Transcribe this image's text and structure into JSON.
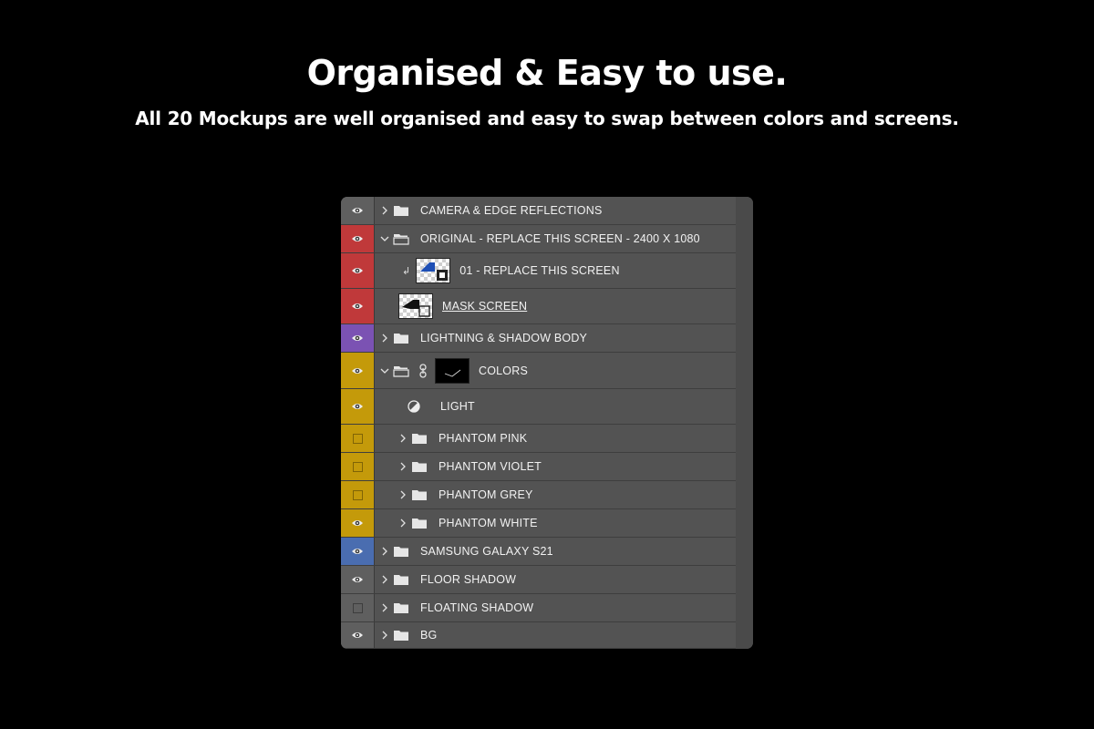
{
  "header": {
    "title": "Organised & Easy to use.",
    "subtitle": "All 20 Mockups are well organised and easy to swap between colors and screens."
  },
  "colors": {
    "red": "#c0393a",
    "violet": "#7b52b3",
    "yellow": "#c49a0a",
    "blue": "#4a6db0",
    "grey": "#5f5f5f"
  },
  "layers": [
    {
      "name": "CAMERA & EDGE REFLECTIONS",
      "type": "group",
      "expanded": false,
      "indent": 0,
      "color": "grey",
      "visible": true
    },
    {
      "name": "ORIGINAL - REPLACE THIS SCREEN - 2400 X 1080",
      "type": "group",
      "expanded": true,
      "indent": 0,
      "color": "red",
      "visible": true
    },
    {
      "name": "01 - REPLACE THIS SCREEN",
      "type": "smart-object",
      "indent": 1,
      "color": "red",
      "visible": true,
      "clipped": true
    },
    {
      "name": "MASK SCREEN",
      "type": "shape",
      "indent": 1,
      "color": "red",
      "visible": true,
      "underlined": true
    },
    {
      "name": "LIGHTNING & SHADOW BODY",
      "type": "group",
      "expanded": false,
      "indent": 0,
      "color": "violet",
      "visible": true
    },
    {
      "name": "COLORS",
      "type": "group-mask",
      "expanded": true,
      "indent": 0,
      "color": "yellow",
      "visible": true
    },
    {
      "name": "LIGHT",
      "type": "adjustment",
      "indent": 1,
      "color": "yellow",
      "visible": true
    },
    {
      "name": "PHANTOM PINK",
      "type": "group",
      "expanded": false,
      "indent": 1,
      "color": "yellow",
      "visible": false
    },
    {
      "name": "PHANTOM VIOLET",
      "type": "group",
      "expanded": false,
      "indent": 1,
      "color": "yellow",
      "visible": false
    },
    {
      "name": "PHANTOM GREY",
      "type": "group",
      "expanded": false,
      "indent": 1,
      "color": "yellow",
      "visible": false
    },
    {
      "name": "PHANTOM WHITE",
      "type": "group",
      "expanded": false,
      "indent": 1,
      "color": "yellow",
      "visible": true
    },
    {
      "name": "SAMSUNG GALAXY S21",
      "type": "group",
      "expanded": false,
      "indent": 0,
      "color": "blue",
      "visible": true
    },
    {
      "name": "FLOOR SHADOW",
      "type": "group",
      "expanded": false,
      "indent": 0,
      "color": "grey",
      "visible": true
    },
    {
      "name": "FLOATING SHADOW",
      "type": "group",
      "expanded": false,
      "indent": 0,
      "color": "grey",
      "visible": false
    },
    {
      "name": "BG",
      "type": "group",
      "expanded": false,
      "indent": 0,
      "color": "grey",
      "visible": true
    }
  ]
}
